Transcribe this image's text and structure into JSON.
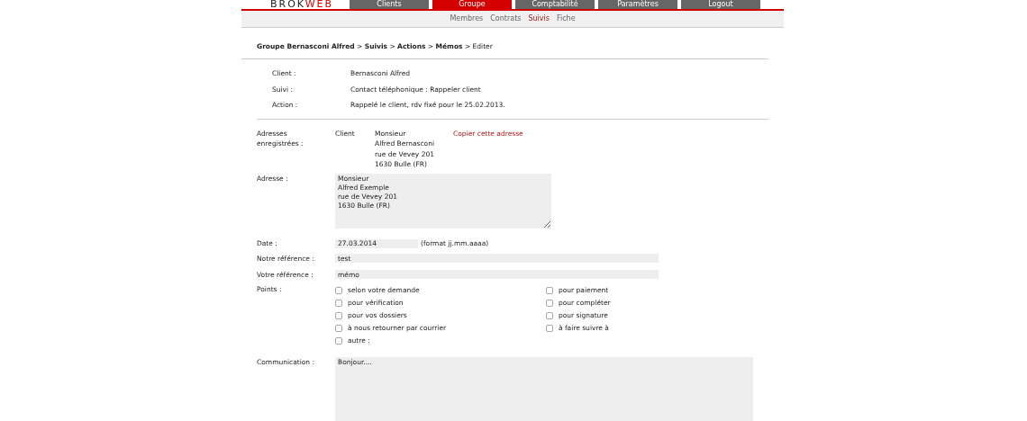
{
  "logo": {
    "part_1": "BROK",
    "part_2": "WEB"
  },
  "main_tabs": [
    {
      "label": "Clients",
      "selected": false
    },
    {
      "label": "Groupe",
      "selected": true
    },
    {
      "label": "Comptabilité",
      "selected": false
    },
    {
      "label": "Paramètres",
      "selected": false
    },
    {
      "label": "Logout",
      "selected": false
    }
  ],
  "sub_tabs": [
    {
      "label": "Membres",
      "selected": false
    },
    {
      "label": "Contrats",
      "selected": false
    },
    {
      "label": "Suivis",
      "selected": true
    },
    {
      "label": "Fiche",
      "selected": false
    }
  ],
  "breadcrumb": {
    "path": [
      "Groupe Bernasconi Alfred",
      "Suivis",
      "Actions",
      "Mémos"
    ],
    "current": "Editer",
    "separator": ">"
  },
  "info": [
    {
      "label": "Client :",
      "value": "Bernasconi Alfred"
    },
    {
      "label": "Suivi :",
      "value": "Contact téléphonique : Rappeler client"
    },
    {
      "label": "Action :",
      "value": "Rappelé le client, rdv fixé pour le 25.02.2013."
    }
  ],
  "saved_addresses": {
    "label": "Adresses enregistrées :",
    "type": "Client",
    "lines": [
      "Monsieur",
      "Alfred Bernasconi",
      "rue de Vevey 201",
      "1630 Bulle (FR)"
    ],
    "link": "Copier cette adresse"
  },
  "address": {
    "label": "Adresse :",
    "value": "Monsieur\nAlfred Exemple\nrue de Vevey 201\n1630 Bulle (FR)"
  },
  "date": {
    "label": "Date :",
    "value": "27.03.2014",
    "hint": "(format jj.mm.aaaa)"
  },
  "our_reference": {
    "label": "Notre référence :",
    "value": "test"
  },
  "your_reference": {
    "label": "Votre référence :",
    "value": "mémo"
  },
  "points": {
    "label": "Points :",
    "columns": [
      [
        {
          "label": "selon votre demande",
          "checked": false
        },
        {
          "label": "pour vérification",
          "checked": false
        },
        {
          "label": "pour vos dossiers",
          "checked": false
        },
        {
          "label": "à nous retourner par courrier",
          "checked": false
        },
        {
          "label": "autre :",
          "checked": false
        }
      ],
      [
        {
          "label": "pour paiement",
          "checked": false
        },
        {
          "label": "pour compléter",
          "checked": false
        },
        {
          "label": "pour signature",
          "checked": false
        },
        {
          "label": "à faire suivre à",
          "checked": false
        }
      ]
    ]
  },
  "communication": {
    "label": "Communication :",
    "value": "Bonjour...."
  }
}
